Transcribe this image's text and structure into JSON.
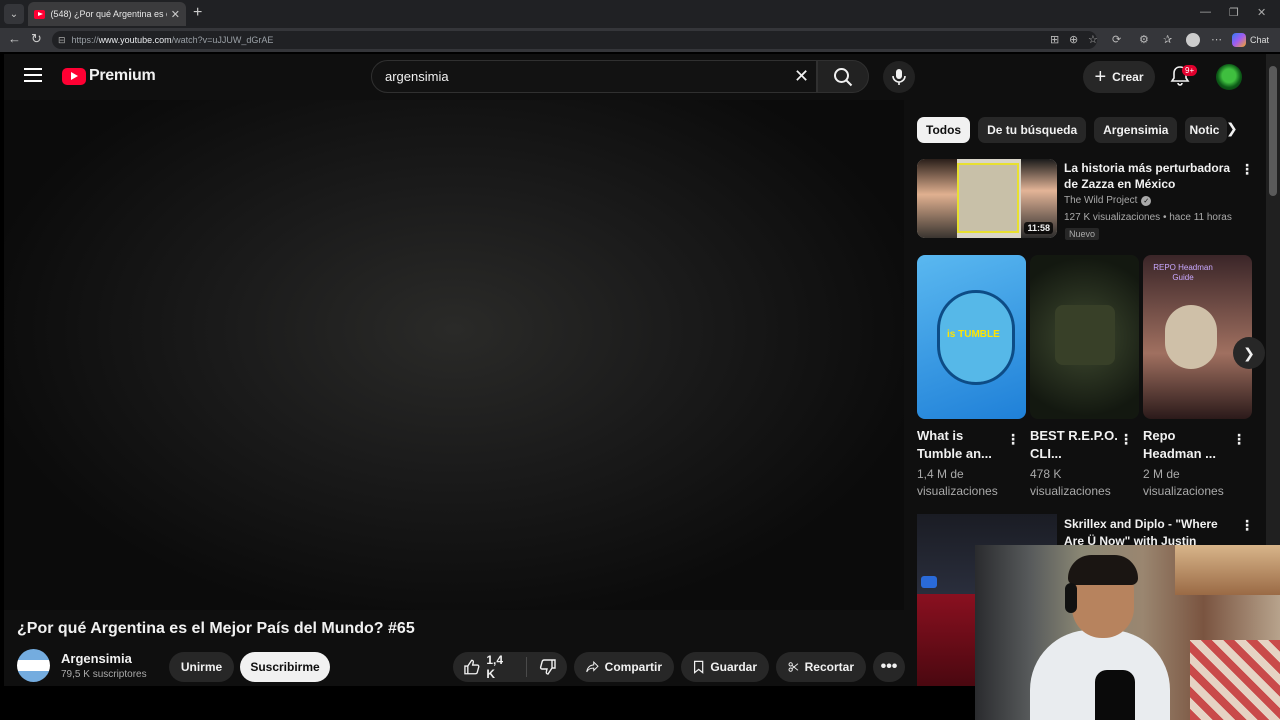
{
  "browser": {
    "tab_title": "(548) ¿Por qué Argentina es el Me...",
    "url_prefix": "https://",
    "url_domain": "www.youtube.com",
    "url_path": "/watch?v=uJJUW_dGrAE",
    "chat_label": "Chat"
  },
  "header": {
    "logo_text": "Premium",
    "search_value": "argensimia",
    "create_label": "Crear",
    "notification_badge": "9+"
  },
  "video": {
    "title": "¿Por qué Argentina es el Mejor País del Mundo? #65",
    "channel_name": "Argensimia",
    "subscribers": "79,5 K suscriptores",
    "join_label": "Unirme",
    "subscribe_label": "Suscribirme",
    "like_count": "1,4 K",
    "share_label": "Compartir",
    "save_label": "Guardar",
    "clip_label": "Recortar"
  },
  "sidebar": {
    "chips": [
      {
        "label": "Todos"
      },
      {
        "label": "De tu búsqueda"
      },
      {
        "label": "Argensimia"
      },
      {
        "label": "Notic"
      }
    ],
    "recommended": [
      {
        "title": "La historia más perturbadora de Zazza en México",
        "channel": "The Wild Project",
        "meta": "127 K visualizaciones • hace 11 horas",
        "badge": "Nuevo",
        "duration": "11:58"
      }
    ],
    "shorts": [
      {
        "title": "What is Tumble an...",
        "views": "1,4 M de visualizaciones",
        "thumb_text": "is TUMBLE"
      },
      {
        "title": "BEST R.E.P.O. CLI...",
        "views": "478 K visualizaciones"
      },
      {
        "title": "Repo Headman ...",
        "views": "2 M de visualizaciones",
        "thumb_text": "REPO Headman Guide"
      }
    ],
    "next_video": {
      "title": "Skrillex and Diplo - \"Where Are Ü Now\" with Justin Bieber ..."
    }
  }
}
